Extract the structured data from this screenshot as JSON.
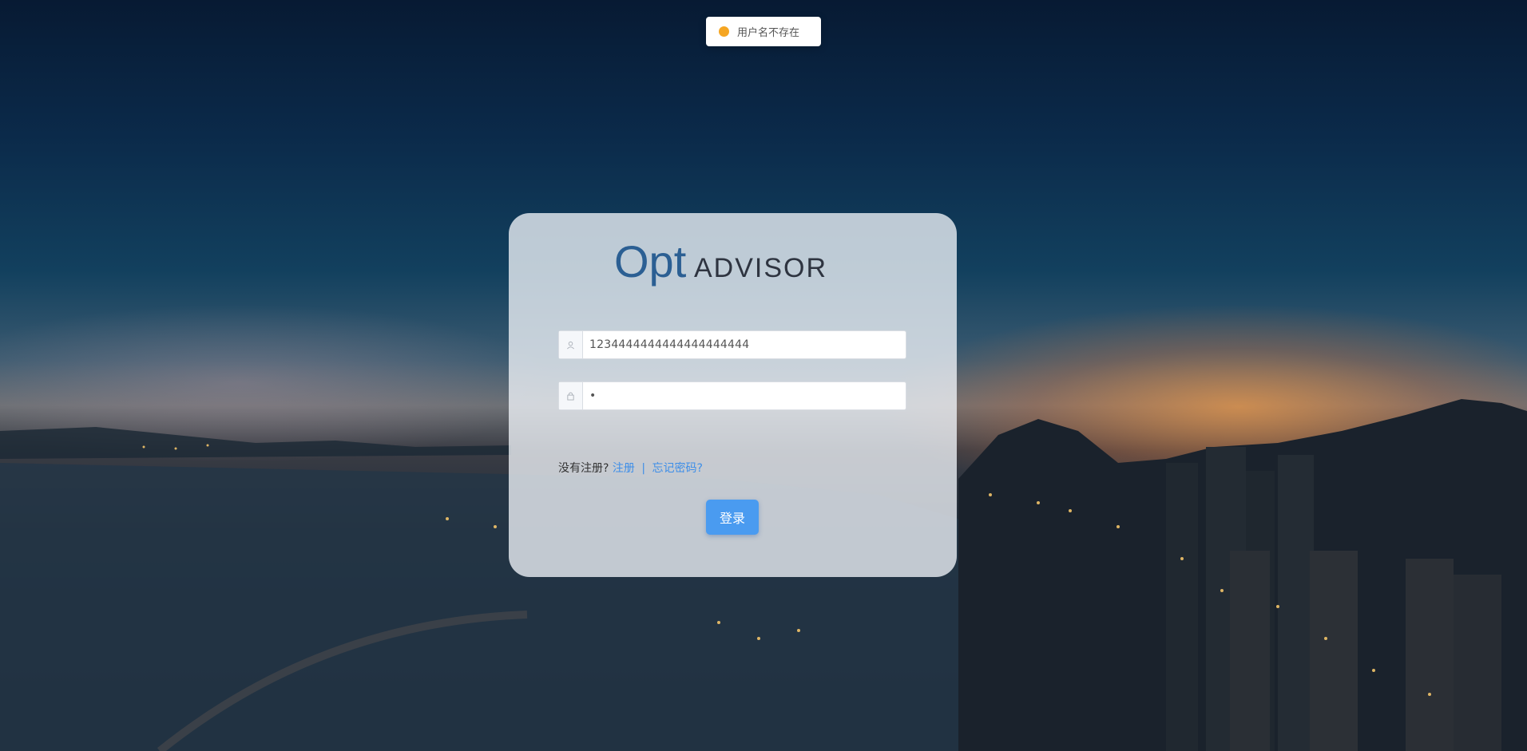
{
  "toast": {
    "message": "用户名不存在",
    "status_color": "#f5a623"
  },
  "logo": {
    "part1": "Opt",
    "part2": "ADVISOR",
    "brand_color": "#2b5f93"
  },
  "form": {
    "username_value": "1234444444444444444444",
    "password_value": "•",
    "user_icon": "user-icon",
    "lock_icon": "lock-icon"
  },
  "links": {
    "prompt": "没有注册?",
    "register": "注册",
    "separator": "|",
    "forgot": "忘记密码?"
  },
  "button": {
    "login_label": "登录"
  },
  "colors": {
    "link": "#3d8ee8",
    "button": "#4a9bf0"
  }
}
